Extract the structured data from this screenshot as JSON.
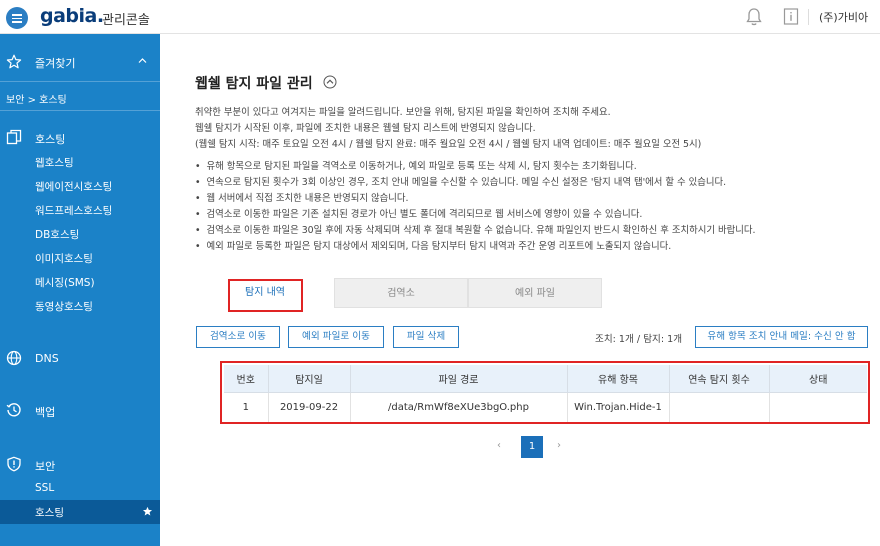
{
  "topbar": {
    "logo": "gabia.",
    "logo_sub": "관리콘솔",
    "account": "(주)가비아"
  },
  "sidebar": {
    "favorites_label": "즐겨찾기",
    "breadcrumb": "보안 > 호스팅",
    "hosting": {
      "label": "호스팅",
      "items": [
        "웹호스팅",
        "웹에이전시호스팅",
        "워드프레스호스팅",
        "DB호스팅",
        "이미지호스팅",
        "메시징(SMS)",
        "동영상호스팅"
      ]
    },
    "dns_label": "DNS",
    "backup_label": "백업",
    "security": {
      "label": "보안",
      "items": [
        "SSL",
        "호스팅"
      ]
    }
  },
  "main": {
    "title": "웹쉘 탐지 파일 관리",
    "desc": [
      "취약한 부분이 있다고 여겨지는 파일을 알려드립니다. 보안을 위해, 탐지된 파일을 확인하여 조치해 주세요.",
      "웹쉘 탐지가 시작된 이후, 파일에 조치한 내용은 웹쉘 탐지 리스트에 반영되지 않습니다.",
      "(웹쉘 탐지 시작: 매주 토요일 오전 4시 / 웹쉘 탐지 완료: 매주 월요일 오전 4시 / 웹쉘 탐지 내역 업데이트: 매주 월요일 오전 5시)"
    ],
    "bullets": [
      "유해 항목으로 탐지된 파일을 격역소로 이동하거나, 예외 파일로 등록 또는 삭제 시, 탐지 횟수는 초기화됩니다.",
      "연속으로 탐지된 횟수가 3회 이상인 경우, 조치 안내 메일을 수신할 수 있습니다. 메일 수신 설정은 '탐지 내역 탭'에서 할 수 있습니다.",
      "웹 서버에서 직접 조치한 내용은 반영되지 않습니다.",
      "검역소로 이동한 파일은 기존 설치된 경로가 아닌 별도 폴더에 격리되므로 웹 서비스에 영향이 있을 수 있습니다.",
      "검역소로 이동한 파일은 30일 후에 자동 삭제되며 삭제 후 절대 복원할 수 없습니다. 유해 파일인지 반드시 확인하신 후 조치하시기 바랍니다.",
      "예외 파일로 등록한 파일은 탐지 대상에서 제외되며, 다음 탐지부터 탐지 내역과 주간 운영 리포트에 노출되지 않습니다."
    ],
    "tabs": [
      "탐지 내역",
      "검역소",
      "예외 파일"
    ],
    "actions": {
      "quarantine": "검역소로 이동",
      "exception": "예외 파일로 이동",
      "delete": "파일 삭제",
      "count": "조치: 1개 / 탐지: 1개",
      "mail": "유해 항목 조치 안내 메일: 수신 안 함"
    },
    "table": {
      "headers": [
        "번호",
        "탐지일",
        "파일 경로",
        "유해 항목",
        "연속 탐지 횟수",
        "상태"
      ],
      "rows": [
        [
          "1",
          "2019-09-22",
          "/data/RmWf8eXUe3bgO.php",
          "Win.Trojan.Hide-1",
          "",
          ""
        ]
      ]
    },
    "pager": {
      "prev": "‹",
      "current": "1",
      "next": "›"
    }
  },
  "colors": {
    "sidebar": "#1b82c8",
    "sidebar_active": "#0b5a98",
    "accent": "#1b6fb9",
    "highlight": "#e02424"
  }
}
